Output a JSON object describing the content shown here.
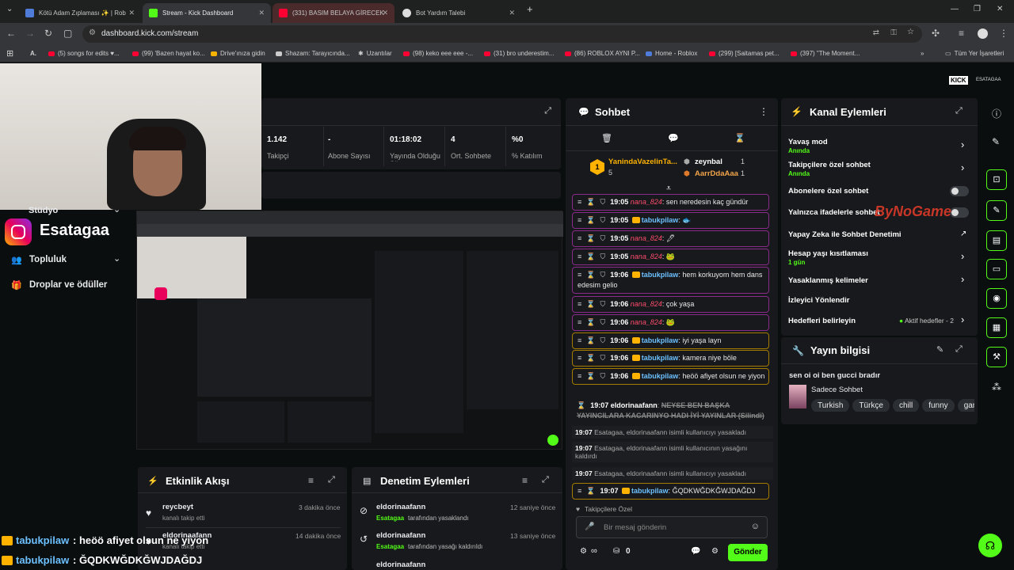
{
  "browser": {
    "tabs": [
      {
        "label": "Kötü Adam Zıplaması ✨ | Rob…",
        "active": false
      },
      {
        "label": "Stream - Kick Dashboard",
        "active": true
      },
      {
        "label": "(331) BASIM BELAYA GİRECEK",
        "active": false
      },
      {
        "label": "Bot Yardım Talebi",
        "active": false
      }
    ],
    "url": "dashboard.kick.com/stream",
    "bookmarks": [
      "A.",
      "(5) songs for edits ♥...",
      "(99) 'Bazen hayat ko...",
      "Drive'ınıza gidin",
      "Shazam: Tarayıcında...",
      "Uzantılar",
      "(98) keko eee eee -...",
      "(31) bro underestim...",
      "(86) ROBLOX AYNI P...",
      "Home - Roblox",
      "(299) [Saitamas pet...",
      "(397) \"The Moment..."
    ],
    "all_bookmarks": "Tüm Yer İşaretleri"
  },
  "header": {
    "channel_short": "ESATAGAA"
  },
  "sidebar": {
    "studio": "Stüdyo",
    "channel_name": "Esatagaa",
    "items": [
      "Topluluk",
      "Droplar ve ödüller"
    ]
  },
  "stats": [
    {
      "value": "1.142",
      "label": "Takipçi"
    },
    {
      "value": "-",
      "label": "Abone Sayısı"
    },
    {
      "value": "01:18:02",
      "label": "Yayında Olduğu Süre"
    },
    {
      "value": "4",
      "label": "Ort. Sohbete"
    },
    {
      "value": "%0",
      "label": "% Katılım"
    }
  ],
  "chat": {
    "title": "Sohbet",
    "top_gifter": {
      "name": "YanindaVazelinTa...",
      "count": "5"
    },
    "gifters": [
      {
        "name": "zeynbal",
        "count": "1"
      },
      {
        "name": "AarrDdaAaa",
        "count": "1"
      }
    ],
    "messages": [
      {
        "time": "19:05",
        "user": "nana_824",
        "text": "sen neredesin kaç gündür",
        "style": "pink"
      },
      {
        "time": "19:05",
        "user": "tabukpilaw",
        "text": "🐟",
        "style": "pink"
      },
      {
        "time": "19:05",
        "user": "nana_824",
        "text": "🖊",
        "style": "pink"
      },
      {
        "time": "19:05",
        "user": "nana_824",
        "text": "🐸",
        "style": "pink"
      },
      {
        "time": "19:06",
        "user": "tabukpilaw",
        "text": "hem korkuyom hem dans edesim gelio",
        "style": "pink"
      },
      {
        "time": "19:06",
        "user": "nana_824",
        "text": "çok yaşa",
        "style": "pink"
      },
      {
        "time": "19:06",
        "user": "nana_824",
        "text": "🐸",
        "style": "pink"
      },
      {
        "time": "19:06",
        "user": "tabukpilaw",
        "text": "iyi yaşa layn",
        "style": "gold"
      },
      {
        "time": "19:06",
        "user": "tabukpilaw",
        "text": "kamera niye böle",
        "style": "gold"
      },
      {
        "time": "19:06",
        "user": "tabukpilaw",
        "text": "heöö afiyet olsun ne yiyon",
        "style": "gold"
      }
    ],
    "deleted_msg": {
      "time": "19:07",
      "user": "eldorinaafann",
      "text": "NEYSE BEN BAŞKA YAYINCILARA KACARINYO HADI İYİ YAYINLAR (Silindi)"
    },
    "system": [
      {
        "time": "19:07",
        "text": "Esatagaa, eldorinaafann isimli kullanıcıyı yasakladı"
      },
      {
        "time": "19:07",
        "text": "Esatagaa, eldorinaafann isimli kullanıcının yasağını kaldırdı"
      },
      {
        "time": "19:07",
        "text": "Esatagaa, eldorinaafann isimli kullanıcıyı yasakladı"
      }
    ],
    "last_msg": {
      "time": "19:07",
      "user": "tabukpilaw",
      "text": "ĞQDKWĞDKĞWJDAĞDJ"
    },
    "followers_only": "Takipçilere Özel",
    "input_placeholder": "Bir mesaj gönderin",
    "points": "0",
    "send": "Gönder"
  },
  "actions": {
    "title": "Kanal Eylemleri",
    "items": [
      {
        "label": "Yavaş mod",
        "sub": "Anında"
      },
      {
        "label": "Takipçilere özel sohbet",
        "sub": "Anında"
      },
      {
        "label": "Abonelere özel sohbet",
        "sub": ""
      },
      {
        "label": "Yalnızca ifadelerle sohbet",
        "sub": ""
      },
      {
        "label": "Yapay Zeka ile Sohbet Denetimi",
        "sub": ""
      },
      {
        "label": "Hesap yaşı kısıtlaması",
        "sub": "1 gün"
      },
      {
        "label": "Yasaklanmış kelimeler",
        "sub": ""
      },
      {
        "label": "İzleyici Yönlendir",
        "sub": ""
      },
      {
        "label": "Hedefleri belirleyin",
        "sub": ""
      }
    ],
    "goals_status": "Aktif hedefler - 2"
  },
  "stream_info": {
    "title": "Yayın bilgisi",
    "stream_title": "sen oi oi ben gucci bradır",
    "category": "Sadece Sohbet",
    "tags": [
      "Turkish",
      "Türkçe",
      "chill",
      "funny",
      "gamin"
    ]
  },
  "activity": {
    "title": "Etkinlik Akışı",
    "rows": [
      {
        "user": "reycbeyt",
        "desc": "kanalı takip etti",
        "time": "3 dakika önce"
      },
      {
        "user": "eldorinaafann",
        "desc": "kanalı takip etti",
        "time": "14 dakika önce"
      }
    ]
  },
  "moderation": {
    "title": "Denetim Eylemleri",
    "rows": [
      {
        "user": "eldorinaafann",
        "by": "Esatagaa",
        "desc": "tarafından yasaklandı",
        "time": "12 saniye önce"
      },
      {
        "user": "eldorinaafann",
        "by": "Esatagaa",
        "desc": "tarafından yasağı kaldırıldı",
        "time": "13 saniye önce"
      },
      {
        "user": "eldorinaafann",
        "by": "",
        "desc": "",
        "time": ""
      }
    ]
  },
  "overlay": {
    "lines": [
      {
        "user": "tabukpilaw",
        "text": ": heöö afiyet olsun ne yiyon"
      },
      {
        "user": "tabukpilaw",
        "text": ": ĞQDKWĞDKĞWJDAĞDJ"
      }
    ],
    "watermark": "ByNoGame"
  },
  "colors": {
    "kick_green": "#53fc18",
    "panel": "#17191c",
    "pink_border": "#8a2a8a",
    "gold_border": "#a57b00"
  }
}
